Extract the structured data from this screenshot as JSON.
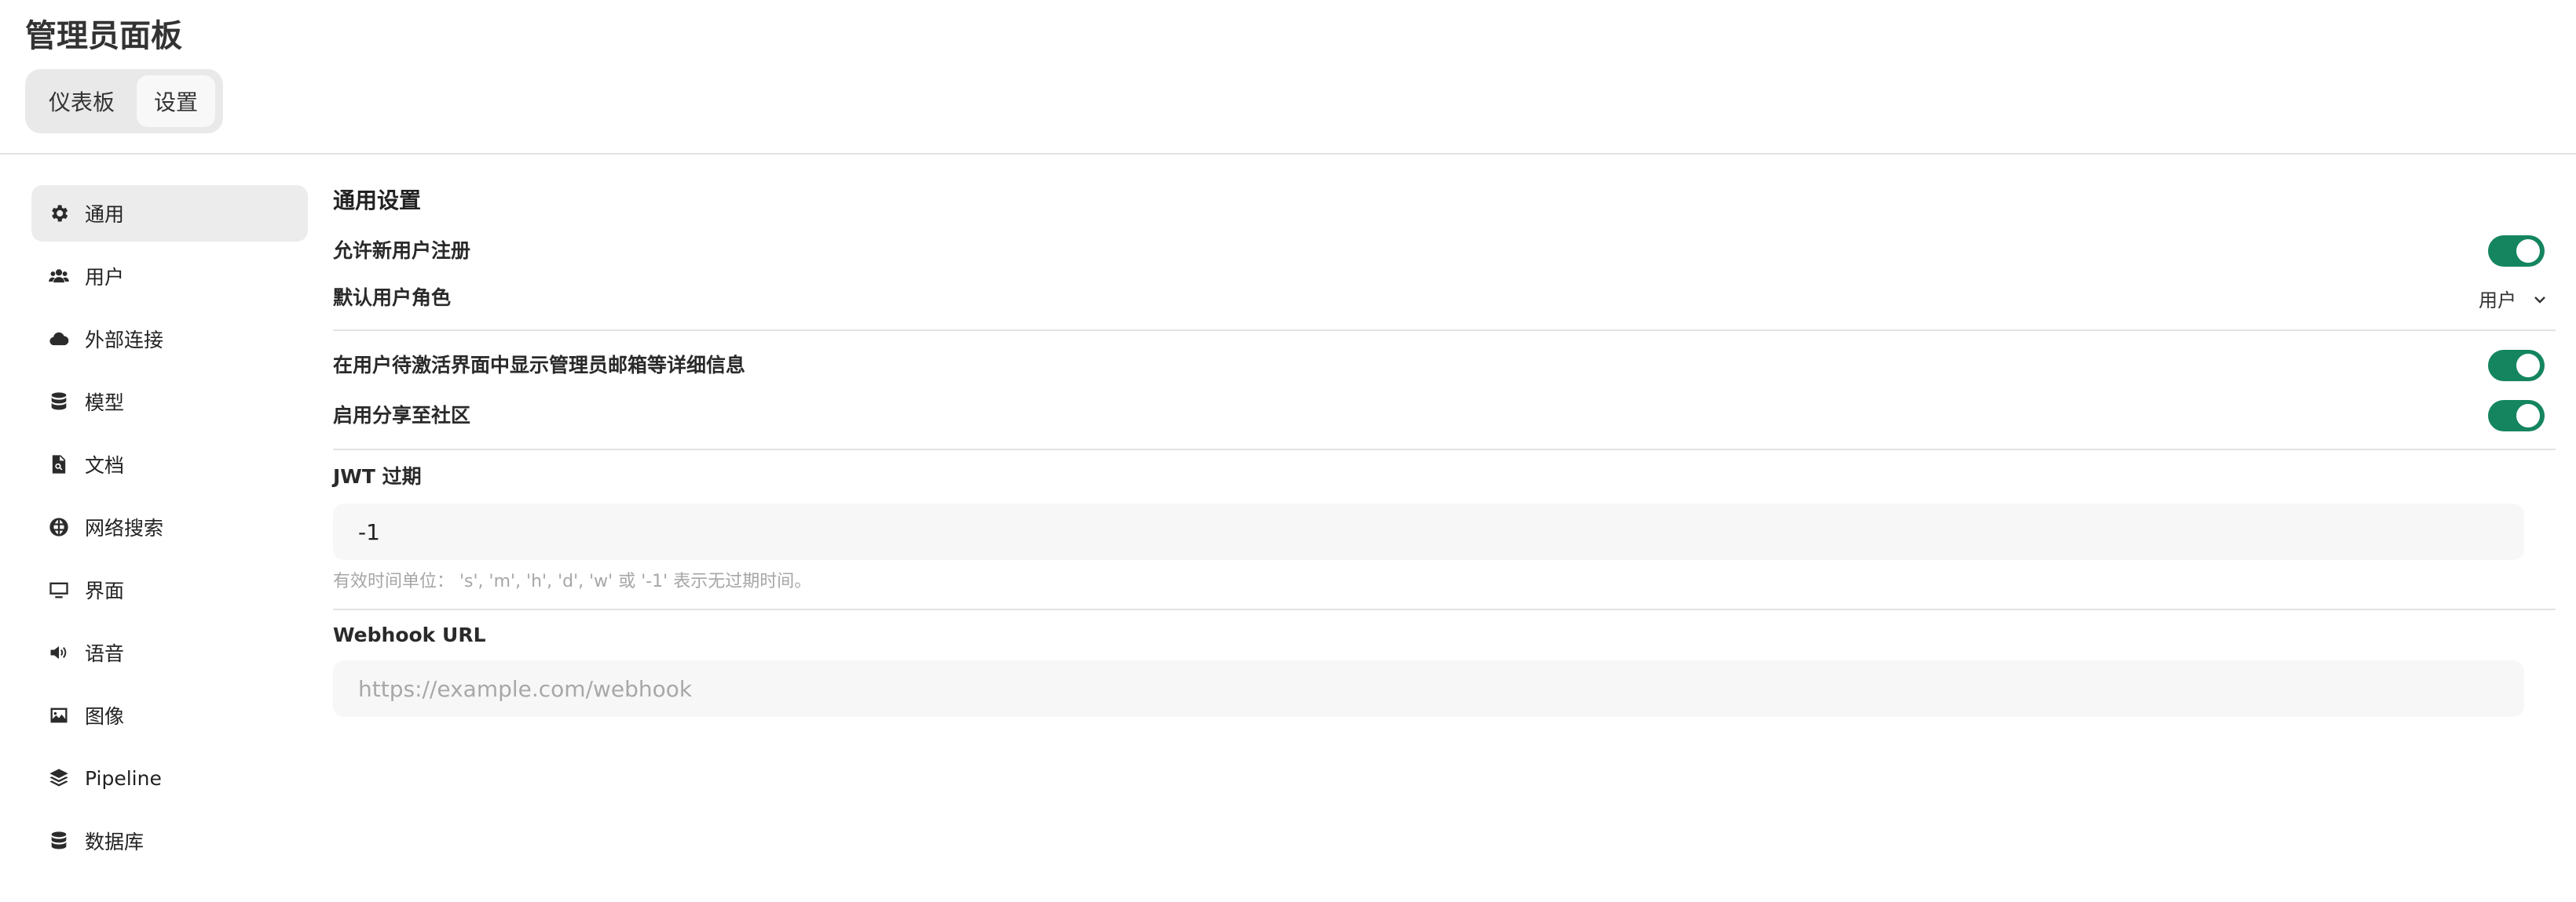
{
  "header": {
    "title": "管理员面板",
    "tabs": [
      {
        "label": "仪表板",
        "active": false
      },
      {
        "label": "设置",
        "active": true
      }
    ]
  },
  "sidebar": {
    "items": [
      {
        "label": "通用",
        "icon": "gear-icon",
        "active": true
      },
      {
        "label": "用户",
        "icon": "users-icon",
        "active": false
      },
      {
        "label": "外部连接",
        "icon": "cloud-icon",
        "active": false
      },
      {
        "label": "模型",
        "icon": "database-icon",
        "active": false
      },
      {
        "label": "文档",
        "icon": "document-search-icon",
        "active": false
      },
      {
        "label": "网络搜索",
        "icon": "globe-icon",
        "active": false
      },
      {
        "label": "界面",
        "icon": "monitor-icon",
        "active": false
      },
      {
        "label": "语音",
        "icon": "speaker-icon",
        "active": false
      },
      {
        "label": "图像",
        "icon": "image-icon",
        "active": false
      },
      {
        "label": "Pipeline",
        "icon": "layers-icon",
        "active": false
      },
      {
        "label": "数据库",
        "icon": "database-icon",
        "active": false
      }
    ]
  },
  "main": {
    "section_title": "通用设置",
    "allow_signup": {
      "label": "允许新用户注册",
      "enabled": true
    },
    "default_role": {
      "label": "默认用户角色",
      "value": "用户"
    },
    "show_admin_details": {
      "label": "在用户待激活界面中显示管理员邮箱等详细信息",
      "enabled": true
    },
    "community_sharing": {
      "label": "启用分享至社区",
      "enabled": true
    },
    "jwt": {
      "label": "JWT 过期",
      "value": "-1",
      "hint": "有效时间单位：  's', 'm', 'h', 'd', 'w' 或 '-1' 表示无过期时间。"
    },
    "webhook": {
      "label": "Webhook URL",
      "value": "",
      "placeholder": "https://example.com/webhook"
    }
  },
  "colors": {
    "toggle_on": "#14855f",
    "active_item_bg": "#ececec",
    "divider": "#e3e3e3"
  }
}
